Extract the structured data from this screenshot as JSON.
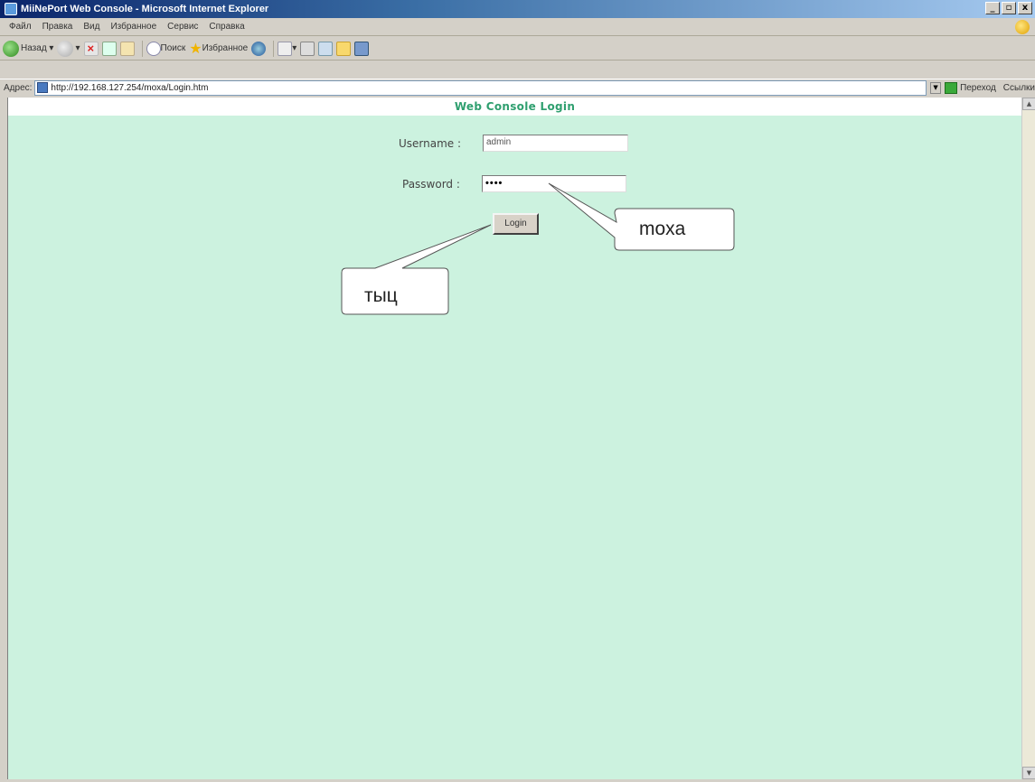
{
  "window": {
    "title": "MiiNePort Web Console - Microsoft Internet Explorer",
    "buttons": [
      "_",
      "▫",
      "x"
    ]
  },
  "menu": {
    "items": [
      "Файл",
      "Правка",
      "Вид",
      "Избранное",
      "Сервис",
      "Справка"
    ]
  },
  "toolbar": {
    "back_label": "Назад",
    "search_label": "Поиск",
    "favorites_label": "Избранное"
  },
  "address": {
    "label": "Адрес:",
    "url": "http://192.168.127.254/moxa/Login.htm",
    "go_label": "Переход",
    "links_label": "Ссылки"
  },
  "page": {
    "title": "Web Console Login",
    "username_label": "Username :",
    "username_value": "admin",
    "password_label": "Password :",
    "password_mask": "••••",
    "login_label": "Login"
  },
  "annotations": {
    "password_callout": "moxa",
    "button_callout": "тыц"
  }
}
